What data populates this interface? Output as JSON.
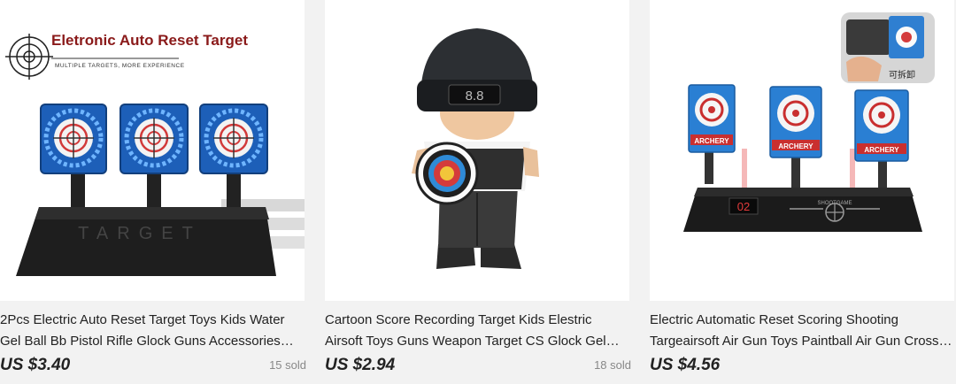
{
  "products": [
    {
      "banner_title": "Eletronic Auto Reset Target",
      "banner_subtitle": "MULTIPLE TARGETS, MORE EXPERIENCE",
      "base_label": "TARGET",
      "title": "2Pcs Electric Auto Reset Target Toys Kids Water Gel Ball Bb Pistol Rifle Glock Guns Accessories Shooting Target",
      "price": "US $3.40",
      "sold": "15 sold"
    },
    {
      "visor_display": "8.8",
      "title": "Cartoon Score Recording Target Kids Elestric Airsoft Toys Guns Weapon Target CS Glock Gel Ball Blaster Accessories",
      "price": "US $2.94",
      "sold": "18 sold"
    },
    {
      "inset_label": "可拆卸",
      "target_label": "ARCHERY",
      "score_display": "02",
      "brand_label": "SHOOTGAME",
      "title": "Electric Automatic Reset Scoring Shooting Targeairsoft Air Gun Toys Paintball Air Gun Cross Bow Accessories",
      "price": "US $4.56",
      "sold": ""
    }
  ]
}
